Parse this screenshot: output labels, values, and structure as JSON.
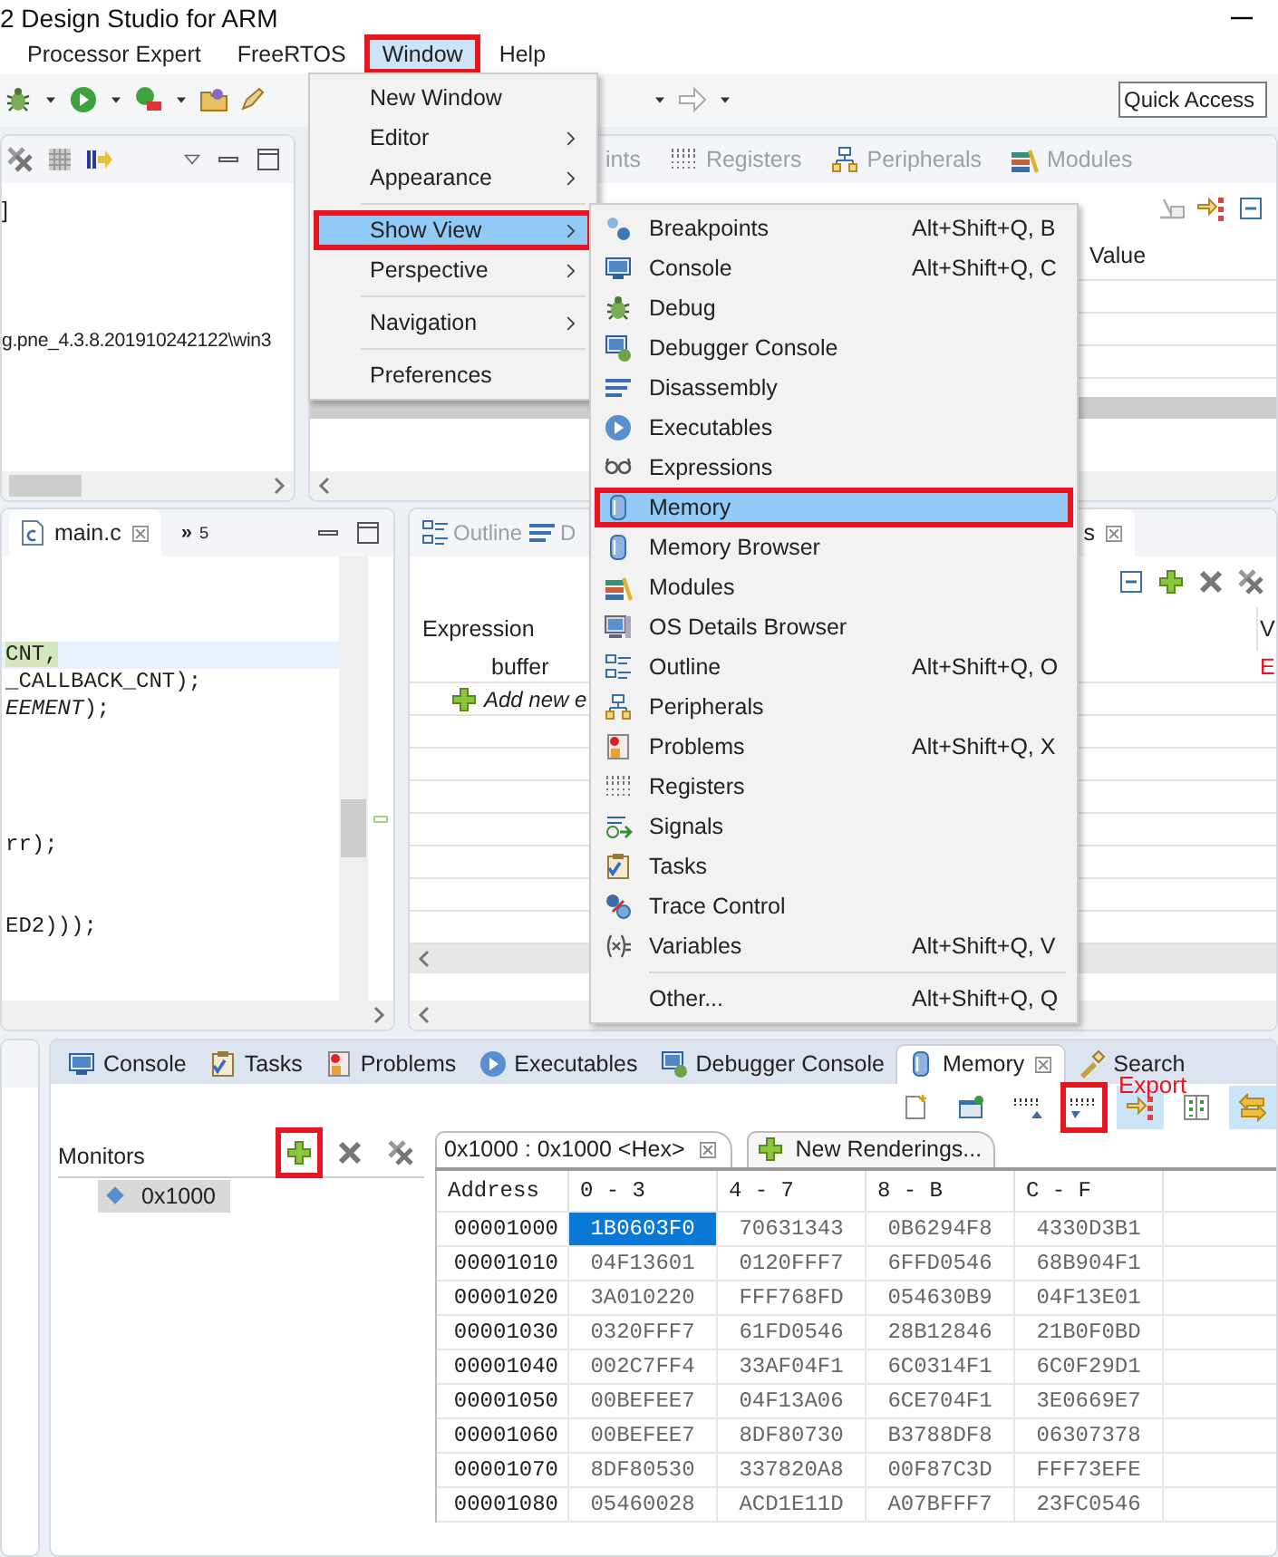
{
  "title_bar": {
    "title": "2 Design Studio for ARM"
  },
  "menu_bar": [
    {
      "label": "Processor Expert",
      "selected": false,
      "annotated": false
    },
    {
      "label": "FreeRTOS",
      "selected": false,
      "annotated": false
    },
    {
      "label": "Window",
      "selected": true,
      "annotated": true
    },
    {
      "label": "Help",
      "selected": false,
      "annotated": false
    }
  ],
  "toolbar": {
    "quick_access": "Quick Access"
  },
  "debug_view": {
    "lines": [
      "]",
      "g.pne_4.3.8.201910242122\\win3"
    ]
  },
  "variables_view": {
    "tabs": [
      {
        "label": "ints",
        "kind": "partial"
      },
      {
        "label": "Registers",
        "kind": "registers"
      },
      {
        "label": "Peripherals",
        "kind": "peripherals"
      },
      {
        "label": "Modules",
        "kind": "modules"
      }
    ],
    "columns": [
      "Value"
    ]
  },
  "editor": {
    "tabs": [
      {
        "label": "main.c",
        "selected": true
      }
    ],
    "overflow": {
      "symbol": "»",
      "count": "5"
    },
    "lines": [
      {
        "kind": "code",
        "text": "CNT,",
        "current": true
      },
      {
        "kind": "code",
        "text": "_CALLBACK_CNT);",
        "current": false
      },
      {
        "kind": "code",
        "text": "*EEMENT*);",
        "current": false
      },
      {
        "kind": "blank"
      },
      {
        "kind": "blank"
      },
      {
        "kind": "blank"
      },
      {
        "kind": "blank"
      },
      {
        "kind": "code",
        "text": "rr);",
        "current": false
      },
      {
        "kind": "blank"
      },
      {
        "kind": "blank"
      },
      {
        "kind": "code",
        "text": "ED2)));",
        "current": false
      }
    ]
  },
  "expressions_view": {
    "tabs": [
      {
        "label": "Outline",
        "kind": "outline",
        "selected": false
      },
      {
        "label": "D",
        "kind": "disassembly",
        "selected": false
      },
      {
        "label": "s",
        "kind": "partial",
        "selected": true
      }
    ],
    "columns": [
      "Expression",
      "V"
    ],
    "rows": [
      {
        "kind": "entry",
        "expression": "buffer",
        "value": "E"
      },
      {
        "kind": "add",
        "expression": "Add new e"
      }
    ]
  },
  "window_menu": {
    "items": [
      {
        "label": "New Window",
        "submenu": false,
        "selected": false,
        "annotated": false,
        "separator_before": false
      },
      {
        "label": "Editor",
        "submenu": true,
        "selected": false,
        "annotated": false,
        "separator_before": false
      },
      {
        "label": "Appearance",
        "submenu": true,
        "selected": false,
        "annotated": false,
        "separator_before": false
      },
      {
        "label": "Show View",
        "submenu": true,
        "selected": true,
        "annotated": true,
        "separator_before": true
      },
      {
        "label": "Perspective",
        "submenu": true,
        "selected": false,
        "annotated": false,
        "separator_before": false
      },
      {
        "label": "Navigation",
        "submenu": true,
        "selected": false,
        "annotated": false,
        "separator_before": true
      },
      {
        "label": "Preferences",
        "submenu": false,
        "selected": false,
        "annotated": false,
        "separator_before": true
      }
    ]
  },
  "show_view_menu": {
    "items": [
      {
        "label": "Breakpoints",
        "kind": "breakpoints",
        "shortcut": "Alt+Shift+Q, B",
        "selected": false,
        "annotated": false,
        "separator_before": false
      },
      {
        "label": "Console",
        "kind": "console",
        "shortcut": "Alt+Shift+Q, C",
        "selected": false,
        "annotated": false,
        "separator_before": false
      },
      {
        "label": "Debug",
        "kind": "debug",
        "selected": false,
        "annotated": false,
        "separator_before": false
      },
      {
        "label": "Debugger Console",
        "kind": "debugger_console",
        "selected": false,
        "annotated": false,
        "separator_before": false
      },
      {
        "label": "Disassembly",
        "kind": "disassembly",
        "selected": false,
        "annotated": false,
        "separator_before": false
      },
      {
        "label": "Executables",
        "kind": "executables",
        "selected": false,
        "annotated": false,
        "separator_before": false
      },
      {
        "label": "Expressions",
        "kind": "expressions",
        "selected": false,
        "annotated": false,
        "separator_before": false
      },
      {
        "label": "Memory",
        "kind": "memory",
        "selected": true,
        "annotated": true,
        "separator_before": false
      },
      {
        "label": "Memory Browser",
        "kind": "memory",
        "selected": false,
        "annotated": false,
        "separator_before": false
      },
      {
        "label": "Modules",
        "kind": "modules",
        "selected": false,
        "annotated": false,
        "separator_before": false
      },
      {
        "label": "OS Details Browser",
        "kind": "os_details",
        "selected": false,
        "annotated": false,
        "separator_before": false
      },
      {
        "label": "Outline",
        "kind": "outline",
        "shortcut": "Alt+Shift+Q, O",
        "selected": false,
        "annotated": false,
        "separator_before": false
      },
      {
        "label": "Peripherals",
        "kind": "peripherals",
        "selected": false,
        "annotated": false,
        "separator_before": false
      },
      {
        "label": "Problems",
        "kind": "problems",
        "shortcut": "Alt+Shift+Q, X",
        "selected": false,
        "annotated": false,
        "separator_before": false
      },
      {
        "label": "Registers",
        "kind": "registers",
        "selected": false,
        "annotated": false,
        "separator_before": false
      },
      {
        "label": "Signals",
        "kind": "signals",
        "selected": false,
        "annotated": false,
        "separator_before": false
      },
      {
        "label": "Tasks",
        "kind": "tasks",
        "selected": false,
        "annotated": false,
        "separator_before": false
      },
      {
        "label": "Trace Control",
        "kind": "trace",
        "selected": false,
        "annotated": false,
        "separator_before": false
      },
      {
        "label": "Variables",
        "kind": "variables",
        "shortcut": "Alt+Shift+Q, V",
        "selected": false,
        "annotated": false,
        "separator_before": false
      },
      {
        "label": "Other...",
        "kind": "none",
        "shortcut": "Alt+Shift+Q, Q",
        "selected": false,
        "annotated": false,
        "separator_before": true
      }
    ]
  },
  "memory_view": {
    "tabs": [
      {
        "label": "Console",
        "kind": "console",
        "selected": false
      },
      {
        "label": "Tasks",
        "kind": "tasks",
        "selected": false
      },
      {
        "label": "Problems",
        "kind": "problems",
        "selected": false
      },
      {
        "label": "Executables",
        "kind": "executables",
        "selected": false
      },
      {
        "label": "Debugger Console",
        "kind": "debugger_console",
        "selected": false
      },
      {
        "label": "Memory",
        "kind": "memory",
        "selected": true
      },
      {
        "label": "Search",
        "kind": "search",
        "selected": false
      }
    ],
    "annotation": "Export",
    "export_annotated": true,
    "monitors": {
      "title": "Monitors",
      "add_annotated": true,
      "items": [
        {
          "label": "0x1000",
          "selected": true
        }
      ]
    },
    "renderings": {
      "tabs": [
        {
          "label": "0x1000 : 0x1000 <Hex>",
          "kind": "rendering",
          "selected": true
        },
        {
          "label": "New Renderings...",
          "kind": "new",
          "selected": false
        }
      ],
      "address_column": "Address",
      "columns": [
        "0 - 3",
        "4 - 7",
        "8 - B",
        "C - F"
      ],
      "rows": [
        {
          "address": "00001000",
          "cells": [
            {
              "value": "1B0603F0",
              "selected": true
            },
            {
              "value": "70631343",
              "selected": false
            },
            {
              "value": "0B6294F8",
              "selected": false
            },
            {
              "value": "4330D3B1",
              "selected": false
            }
          ]
        },
        {
          "address": "00001010",
          "cells": [
            {
              "value": "04F13601",
              "selected": false
            },
            {
              "value": "0120FFF7",
              "selected": false
            },
            {
              "value": "6FFD0546",
              "selected": false
            },
            {
              "value": "68B904F1",
              "selected": false
            }
          ]
        },
        {
          "address": "00001020",
          "cells": [
            {
              "value": "3A010220",
              "selected": false
            },
            {
              "value": "FFF768FD",
              "selected": false
            },
            {
              "value": "054630B9",
              "selected": false
            },
            {
              "value": "04F13E01",
              "selected": false
            }
          ]
        },
        {
          "address": "00001030",
          "cells": [
            {
              "value": "0320FFF7",
              "selected": false
            },
            {
              "value": "61FD0546",
              "selected": false
            },
            {
              "value": "28B12846",
              "selected": false
            },
            {
              "value": "21B0F0BD",
              "selected": false
            }
          ]
        },
        {
          "address": "00001040",
          "cells": [
            {
              "value": "002C7FF4",
              "selected": false
            },
            {
              "value": "33AF04F1",
              "selected": false
            },
            {
              "value": "6C0314F1",
              "selected": false
            },
            {
              "value": "6C0F29D1",
              "selected": false
            }
          ]
        },
        {
          "address": "00001050",
          "cells": [
            {
              "value": "00BEFEE7",
              "selected": false
            },
            {
              "value": "04F13A06",
              "selected": false
            },
            {
              "value": "6CE704F1",
              "selected": false
            },
            {
              "value": "3E0669E7",
              "selected": false
            }
          ]
        },
        {
          "address": "00001060",
          "cells": [
            {
              "value": "00BEFEE7",
              "selected": false
            },
            {
              "value": "8DF80730",
              "selected": false
            },
            {
              "value": "B3788DF8",
              "selected": false
            },
            {
              "value": "06307378",
              "selected": false
            }
          ]
        },
        {
          "address": "00001070",
          "cells": [
            {
              "value": "8DF80530",
              "selected": false
            },
            {
              "value": "337820A8",
              "selected": false
            },
            {
              "value": "00F87C3D",
              "selected": false
            },
            {
              "value": "FFF73EFE",
              "selected": false
            }
          ]
        },
        {
          "address": "00001080",
          "cells": [
            {
              "value": "05460028",
              "selected": false
            },
            {
              "value": "ACD1E11D",
              "selected": false
            },
            {
              "value": "A07BFFF7",
              "selected": false
            },
            {
              "value": "23FC0546",
              "selected": false
            }
          ]
        }
      ]
    }
  }
}
